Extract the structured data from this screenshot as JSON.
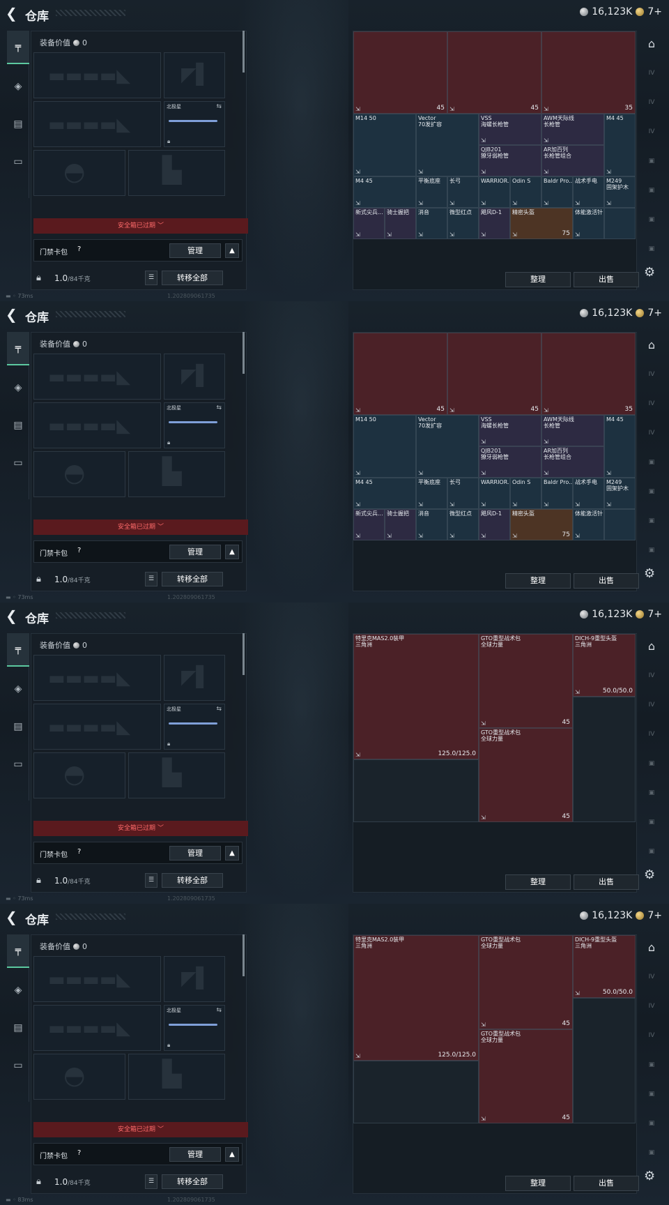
{
  "app": {
    "title": "仓库",
    "currency": "16,123K",
    "gold": "7+"
  },
  "equipment": {
    "value_label": "装备价值",
    "value": "0",
    "secondary_slot_label": "北极星",
    "safe_box_label": "安全箱已过期",
    "card_pack_label": "门禁卡包",
    "help_label": "?",
    "manage_button": "管理",
    "weight_value": "1.0",
    "weight_capacity": "/84千克",
    "transfer_all_button": "转移全部"
  },
  "footer": {
    "ping_1": "73ms",
    "ping_2": "73ms",
    "ping_3": "73ms",
    "ping_4": "83ms",
    "build": "1.202809061735"
  },
  "storage": {
    "sort_button": "整理",
    "sell_button": "出售"
  },
  "grid_a": {
    "items": [
      {
        "name": "",
        "num": "45"
      },
      {
        "name": "",
        "num": "45"
      },
      {
        "name": "",
        "num": "35"
      },
      {
        "name": "M14 50",
        "num": ""
      },
      {
        "name": "Vector\n70发扩容",
        "num": ""
      },
      {
        "name": "VSS\n海螺长枪管",
        "num": ""
      },
      {
        "name": "AWM天际线\n长枪管",
        "num": ""
      },
      {
        "name": "M4 45",
        "num": ""
      },
      {
        "name": "QJB201\n獠牙弱枪管",
        "num": ""
      },
      {
        "name": "AR加百列\n长枪管组合",
        "num": ""
      },
      {
        "name": "M4 45",
        "num": ""
      },
      {
        "name": "平衡底座",
        "num": ""
      },
      {
        "name": "长弓",
        "num": ""
      },
      {
        "name": "WARRIOR..",
        "num": ""
      },
      {
        "name": "Odin S",
        "num": ""
      },
      {
        "name": "Baldr Pro...",
        "num": ""
      },
      {
        "name": "战术手电",
        "num": ""
      },
      {
        "name": "M249\n固架护木",
        "num": ""
      },
      {
        "name": "新式尖兵...",
        "num": ""
      },
      {
        "name": "骑士握把",
        "num": ""
      },
      {
        "name": "消音",
        "num": ""
      },
      {
        "name": "微型红点",
        "num": ""
      },
      {
        "name": "飓风D-1",
        "num": ""
      },
      {
        "name": "精密头盔",
        "num": "75"
      },
      {
        "name": "体能激活针",
        "num": ""
      }
    ]
  },
  "grid_b": {
    "items": [
      {
        "name": "特里克MAS2.0装甲\n三角洲",
        "num": "125.0/125.0"
      },
      {
        "name": "GTO重型战术包\n全球力量",
        "num": "45"
      },
      {
        "name": "DICH-9重型头盔\n三角洲",
        "num": "50.0/50.0"
      },
      {
        "name": "GTO重型战术包\n全球力量",
        "num": "45"
      }
    ]
  },
  "icons": {
    "back": "chevron-left-icon",
    "coin": "coin-icon",
    "gear": "gear-icon"
  }
}
